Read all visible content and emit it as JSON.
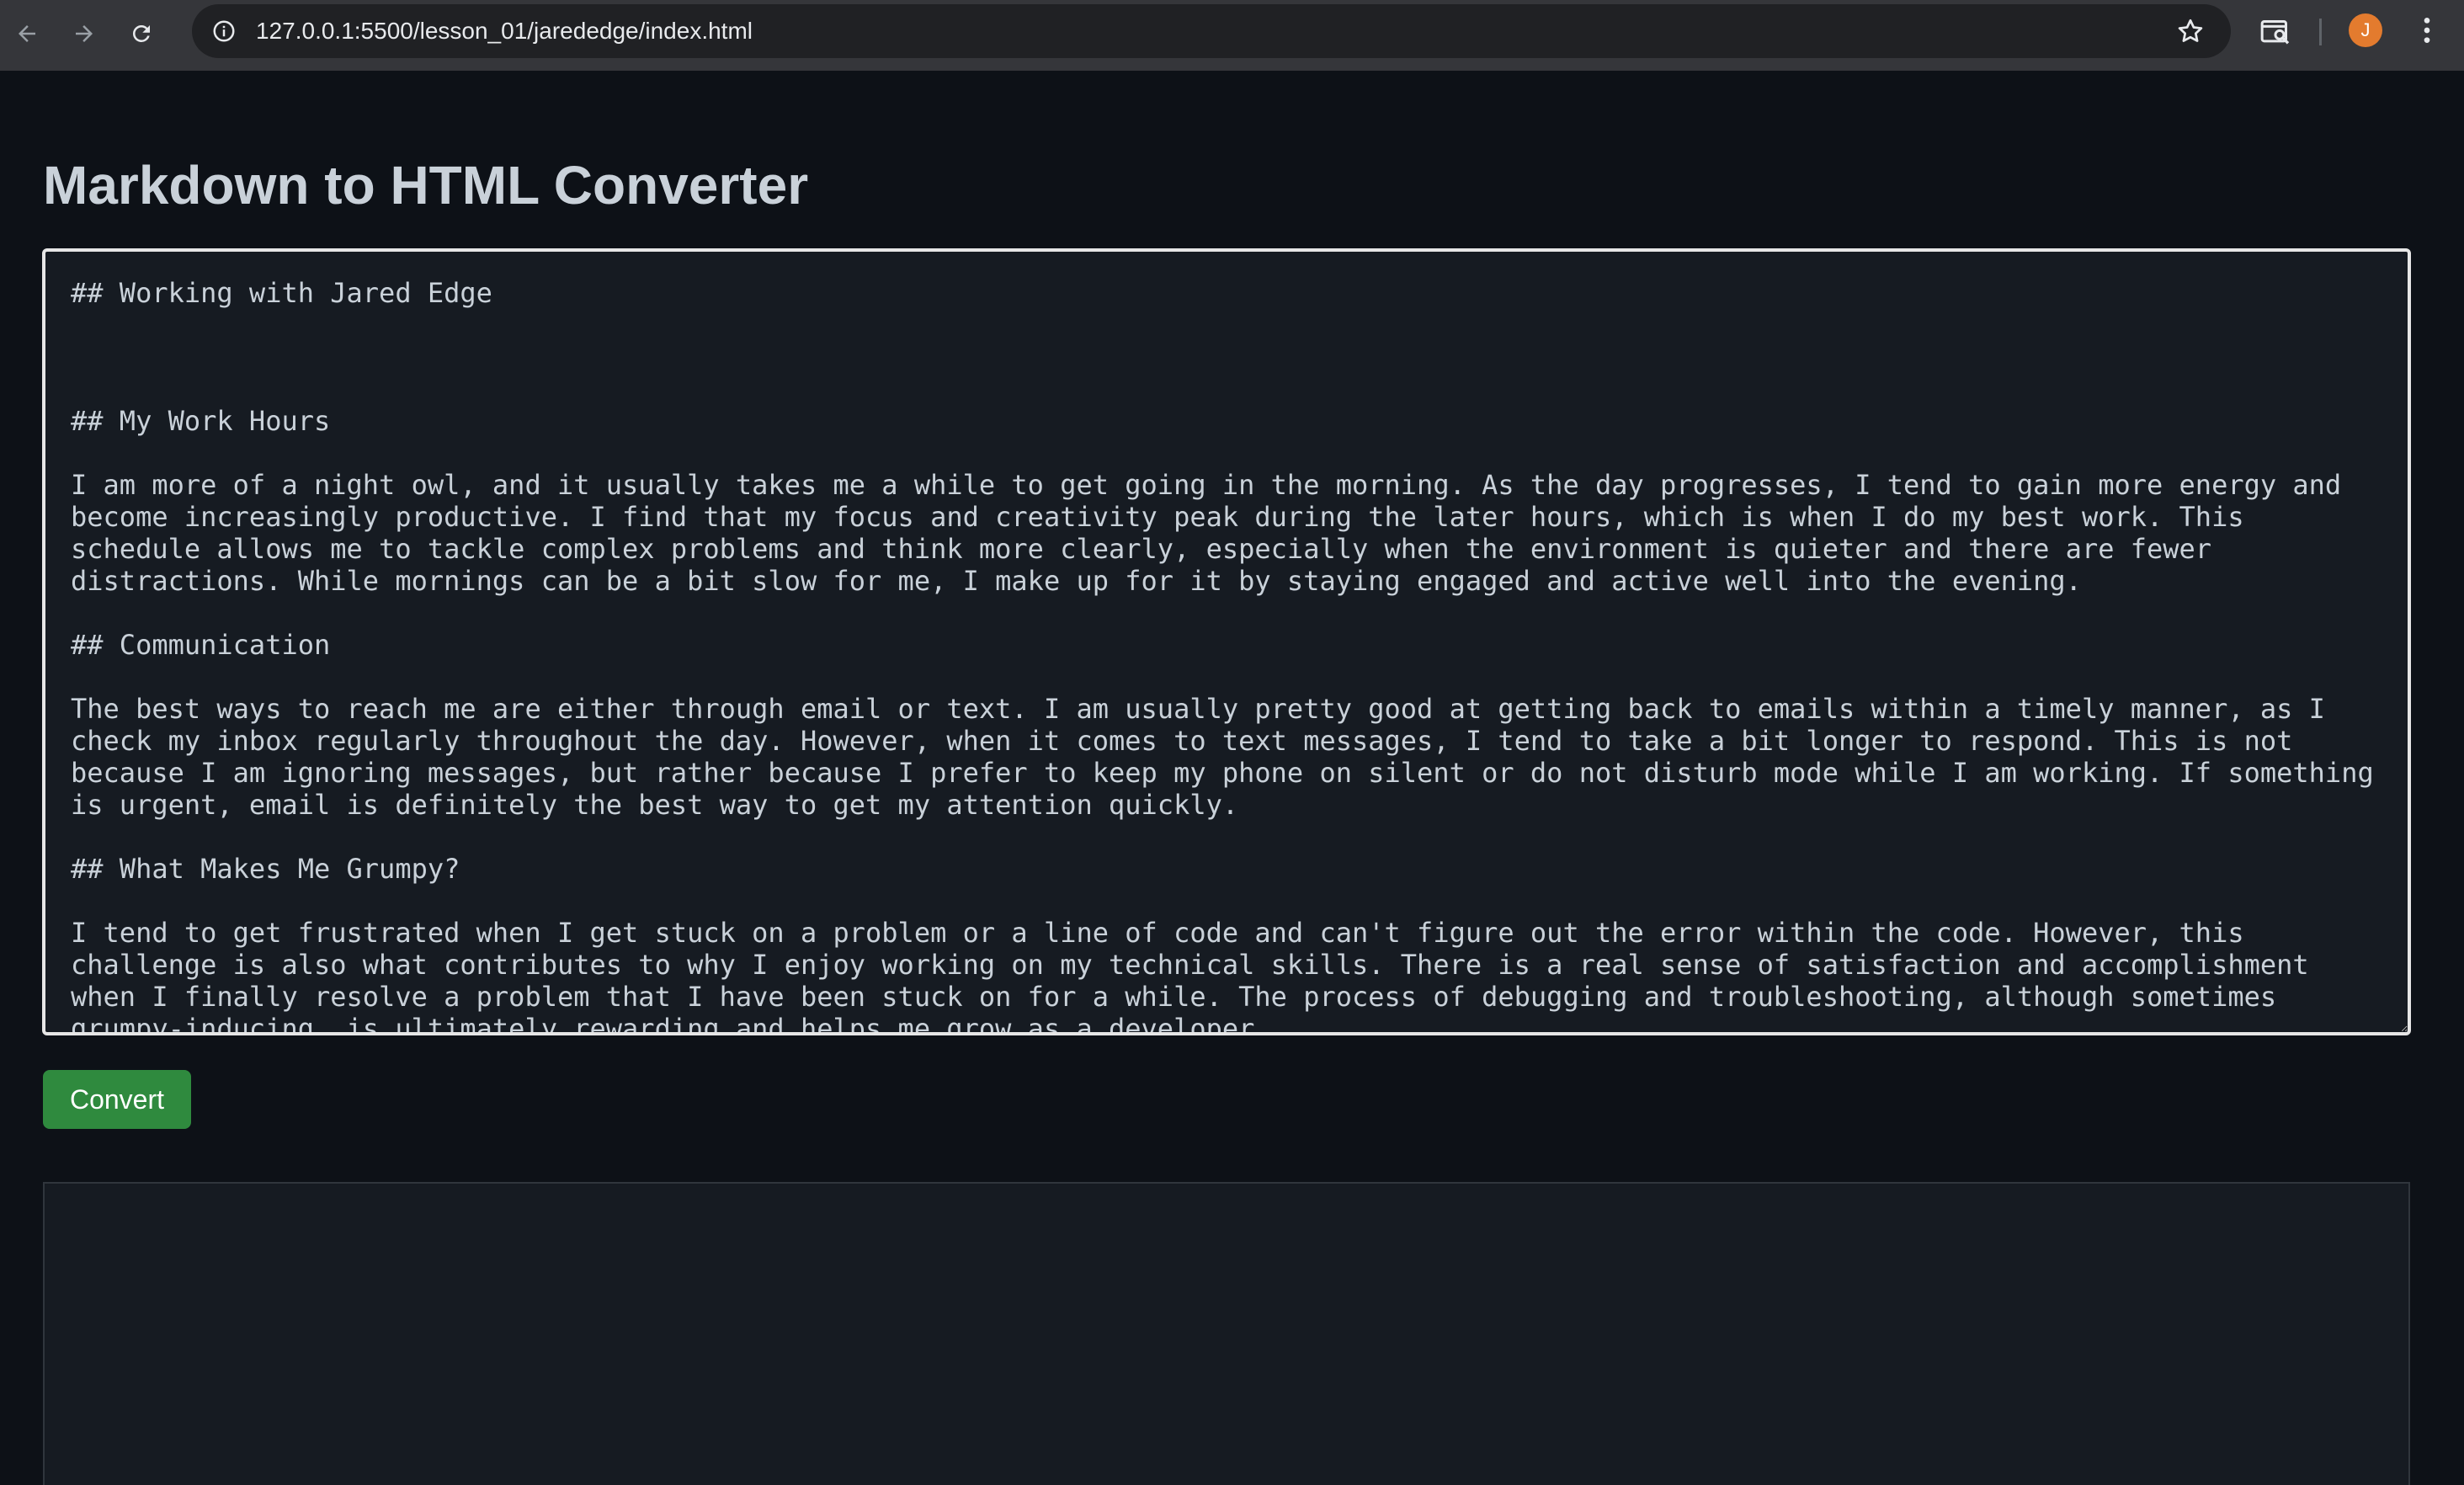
{
  "browser": {
    "url": "127.0.0.1:5500/lesson_01/jarededge/index.html",
    "avatar_letter": "J",
    "colors": {
      "toolbar": "#35363a",
      "omnibox": "#202124",
      "avatar": "#e37b2e"
    }
  },
  "page": {
    "title": "Markdown to HTML Converter",
    "markdown_input": "## Working with Jared Edge\n\n\n\n## My Work Hours\n\nI am more of a night owl, and it usually takes me a while to get going in the morning. As the day progresses, I tend to gain more energy and become increasingly productive. I find that my focus and creativity peak during the later hours, which is when I do my best work. This schedule allows me to tackle complex problems and think more clearly, especially when the environment is quieter and there are fewer distractions. While mornings can be a bit slow for me, I make up for it by staying engaged and active well into the evening.\n\n## Communication\n\nThe best ways to reach me are either through email or text. I am usually pretty good at getting back to emails within a timely manner, as I check my inbox regularly throughout the day. However, when it comes to text messages, I tend to take a bit longer to respond. This is not because I am ignoring messages, but rather because I prefer to keep my phone on silent or do not disturb mode while I am working. If something is urgent, email is definitely the best way to get my attention quickly.\n\n## What Makes Me Grumpy?\n\nI tend to get frustrated when I get stuck on a problem or a line of code and can't figure out the error within the code. However, this challenge is also what contributes to why I enjoy working on my technical skills. There is a real sense of satisfaction and accomplishment when I finally resolve a problem that I have been stuck on for a while. The process of debugging and troubleshooting, although sometimes grumpy-inducing, is ultimately rewarding and helps me grow as a developer.",
    "convert_label": "Convert",
    "output_html": "",
    "colors": {
      "background": "#0d1117",
      "panel": "#161b22",
      "text": "#c9d1d9",
      "button": "#2f8a3e"
    }
  },
  "icons": {
    "back": "arrow-left-icon",
    "forward": "arrow-right-icon",
    "reload": "reload-icon",
    "site_info": "info-icon",
    "bookmark": "star-icon",
    "tab_search": "tab-search-icon",
    "menu": "kebab-menu-icon"
  }
}
